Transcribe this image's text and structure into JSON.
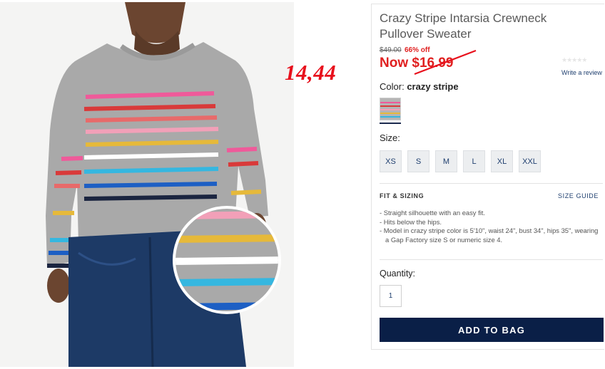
{
  "annotation": {
    "handwritten_price": "14,44"
  },
  "product": {
    "title": "Crazy Stripe Intarsia Crewneck Pullover Sweater",
    "original_price": "$49.00",
    "discount": "66% off",
    "now_price": "Now $16.99",
    "stars": "★★★★★",
    "review_link": "Write a review",
    "color_label": "Color:",
    "color_value": "crazy stripe",
    "size_label": "Size:",
    "sizes": [
      "XS",
      "S",
      "M",
      "L",
      "XL",
      "XXL"
    ],
    "fit_title": "FIT & SIZING",
    "size_guide": "SIZE GUIDE",
    "fit_bullets": [
      "Straight silhouette with an easy fit.",
      "Hits below the hips.",
      "Model in crazy stripe color is 5'10\", waist 24\", bust 34\", hips 35\", wearing a Gap Factory size S or numeric size 4."
    ],
    "quantity_label": "Quantity:",
    "quantity_value": "1",
    "add_to_bag": "ADD TO BAG"
  },
  "colors": {
    "price_red": "#e02020",
    "annotation_red": "#e8101c",
    "button_navy": "#0a1f47",
    "link_blue": "#1f3f6f",
    "sweater_grey": "#a9a9a9",
    "stripes": [
      "#ef5a9a",
      "#d93a3a",
      "#e86a6a",
      "#f2a0b8",
      "#e6b93a",
      "#ffffff",
      "#35b7e0",
      "#1d5fc4",
      "#1b2540"
    ]
  }
}
